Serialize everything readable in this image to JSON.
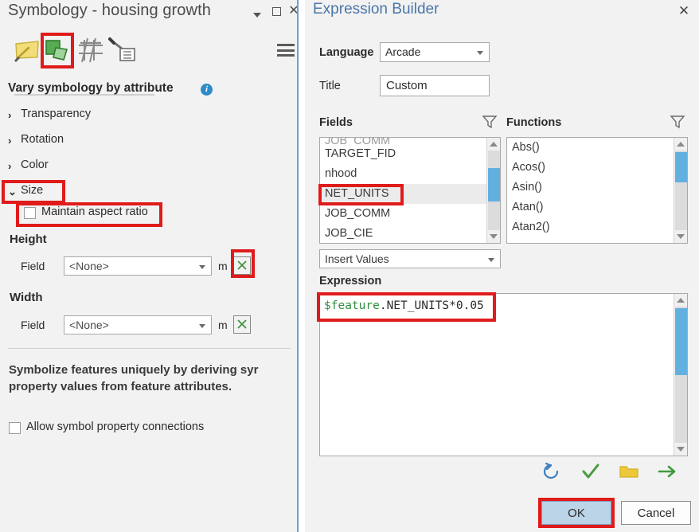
{
  "left_panel": {
    "title": "Symbology - housing growth",
    "title_controls": {
      "menu_caret": "caret-down-icon",
      "maximize": "maximize-icon",
      "close": "✕"
    },
    "toolbar": {
      "icons": [
        {
          "name": "gallery-icon",
          "label": "Gallery"
        },
        {
          "name": "properties-icon",
          "label": "Properties",
          "selected": true
        },
        {
          "name": "structure-icon",
          "label": "Structure"
        },
        {
          "name": "advanced-icon",
          "label": "Advanced symbol options"
        }
      ],
      "menu_label": "hamburger-menu-icon"
    },
    "vary_header": "Vary symbology by attribute",
    "info_badge": "i",
    "accordion": [
      {
        "label": "Transparency",
        "arrow": "›",
        "expanded": false
      },
      {
        "label": "Rotation",
        "arrow": "›",
        "expanded": false
      },
      {
        "label": "Color",
        "arrow": "›",
        "expanded": false
      },
      {
        "label": "Size",
        "arrow": "⌄",
        "expanded": true
      }
    ],
    "maintain_aspect_ratio": {
      "label": "Maintain aspect ratio",
      "checked": false
    },
    "height": {
      "header": "Height",
      "field_label": "Field",
      "field_value": "<None>",
      "unit": "m",
      "expression_button": "expression-x-icon"
    },
    "width": {
      "header": "Width",
      "field_label": "Field",
      "field_value": "<None>",
      "unit": "m",
      "expression_button": "expression-x-icon"
    },
    "description_line1": "Symbolize features uniquely by deriving syr",
    "description_line2": "property values from feature attributes.",
    "allow_connections": {
      "label": "Allow symbol property connections",
      "checked": false
    }
  },
  "dialog": {
    "title": "Expression Builder",
    "close": "✕",
    "language_label": "Language",
    "language_value": "Arcade",
    "title_label": "Title",
    "title_value": "Custom",
    "fields_header": "Fields",
    "functions_header": "Functions",
    "filter_icon": "funnel-filter-icon",
    "fields": [
      {
        "label": "JOB_COMM",
        "clipped": true,
        "selected": false
      },
      {
        "label": "TARGET_FID",
        "clipped": false,
        "selected": false
      },
      {
        "label": "nhood",
        "clipped": false,
        "selected": false
      },
      {
        "label": "NET_UNITS",
        "clipped": false,
        "selected": true
      },
      {
        "label": "JOB_COMM",
        "clipped": false,
        "selected": false
      },
      {
        "label": "JOB_CIE",
        "clipped": false,
        "selected": false
      }
    ],
    "functions": [
      {
        "label": "Abs()"
      },
      {
        "label": "Acos()"
      },
      {
        "label": "Asin()"
      },
      {
        "label": "Atan()"
      },
      {
        "label": "Atan2()"
      }
    ],
    "insert_values_label": "Insert Values",
    "expression_header": "Expression",
    "expression_token_var": "$feature",
    "expression_token_rest": ".NET_UNITS*0.05",
    "action_icons": [
      {
        "name": "reset-icon",
        "color": "#3f7fc1"
      },
      {
        "name": "verify-check-icon",
        "color": "#4a9b3f"
      },
      {
        "name": "open-folder-icon",
        "color": "#e8c030"
      },
      {
        "name": "export-arrow-icon",
        "color": "#3f9b3f"
      }
    ],
    "ok_label": "OK",
    "cancel_label": "Cancel"
  },
  "annotations": {
    "color": "#e01b1b",
    "boxes": [
      {
        "name": "properties-tool-highlight"
      },
      {
        "name": "size-section-highlight"
      },
      {
        "name": "maintain-aspect-ratio-highlight"
      },
      {
        "name": "height-expression-button-highlight"
      },
      {
        "name": "net-units-field-highlight"
      },
      {
        "name": "expression-text-highlight"
      },
      {
        "name": "ok-button-highlight"
      }
    ]
  },
  "colors": {
    "panel_background": "#f2f2f2",
    "dialog_title": "#4a76a8",
    "accent_blue": "#6ba0d4",
    "scrollbar_thumb": "#62b0e0",
    "ok_button_fill": "#bcd4e8",
    "expression_variable": "#2f8f3f",
    "annotation_red": "#e01b1b"
  }
}
